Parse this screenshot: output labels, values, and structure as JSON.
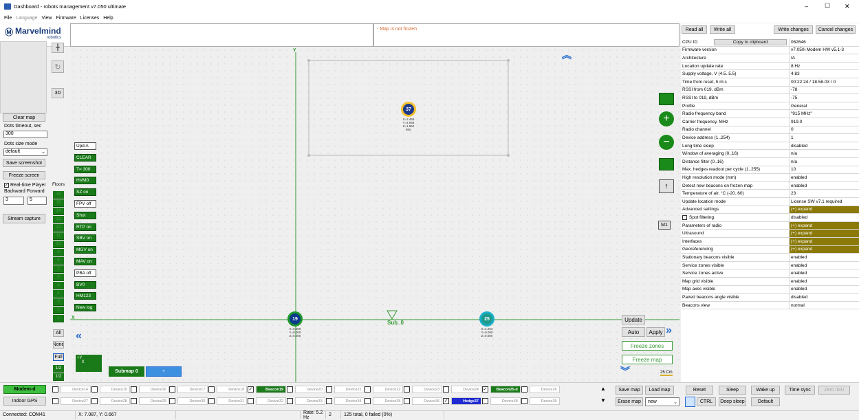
{
  "window": {
    "title": "Dashboard - robots management  v7.050  ultimate",
    "minimize": "–",
    "maximize": "☐",
    "close": "✕"
  },
  "menu": [
    "File",
    "Language",
    "View",
    "Firmware",
    "Licenses",
    "Help"
  ],
  "logo": {
    "name": "Marvelmind",
    "sub": "robotics"
  },
  "map_status": "- Map is not frozen",
  "left": {
    "clear_map": "Clear map",
    "dots_timeout_label": "Dots timeout, sec",
    "dots_timeout": "300",
    "dots_size_label": "Dots size mode",
    "dots_size": "default",
    "save_screenshot": "Save screenshot",
    "freeze_screen": "Freeze screen",
    "realtime_player": "Real-time Player",
    "backward": "Backward",
    "forward": "Forward",
    "backward_val": "3",
    "forward_val": "5",
    "stream_capture": "Stream capture",
    "view_3d": "3D"
  },
  "floors_label": "Floors",
  "floors": [
    "16",
    "15",
    "14",
    "13",
    "12",
    "11",
    "10",
    "9",
    "8",
    "7",
    "6",
    "5",
    "4",
    "3",
    "2",
    "1"
  ],
  "floor_buttons": {
    "all": "All",
    "none": "None",
    "full": "Full",
    "half1": "1/2",
    "half2": "1/2"
  },
  "map_buttons": [
    "Upd A",
    "CLEAR",
    "T= 300",
    "HVM0",
    "SZ on",
    "FPV off",
    "Shot",
    "RTP on",
    "SBV on",
    "MGV on",
    "MAV on",
    "PBA off",
    "BV0",
    "HM123",
    "New log"
  ],
  "map": {
    "x_axis": "X",
    "y_axis": "Y",
    "sub0": "Sub_0",
    "submap_label": "Submap 0",
    "submap_add": "+",
    "m1": "M1",
    "scale": "25 Cm"
  },
  "beacons": [
    {
      "id": "37",
      "coords": "X=2.469\nY=4.693\nZ=1.550\nIMU",
      "color": "#1e3a8a",
      "ring": "#f2c12e"
    },
    {
      "id": "19",
      "coords": "X=0.000\nY=0.000\nZ=0.000",
      "color": "#0b3a8c",
      "ring": "#1e9a2a"
    },
    {
      "id": "25",
      "coords": "X=4.203\nY=0.000\nZ=0.000",
      "color": "#1e9a8c",
      "ring": "#19b0c9"
    }
  ],
  "map_right_buttons": {
    "update": "Update",
    "auto": "Auto",
    "apply": "Apply",
    "freeze_zones": "Freeze zones",
    "freeze_map": "Freeze map"
  },
  "top_right_buttons": {
    "read_all": "Read all",
    "write_all": "Write all",
    "write_changes": "Write changes",
    "cancel_changes": "Cancel changes"
  },
  "props": [
    [
      "CPU ID",
      "062646"
    ],
    [
      "Firmware version",
      "v7.050i Modem HW v5.1-3"
    ],
    [
      "Architecture",
      "IA"
    ],
    [
      "Location update rate",
      "8 Hz"
    ],
    [
      "Supply voltage, V (4.5..5.5)",
      "4.83"
    ],
    [
      "Time from reset, h:m:s",
      "00:22:24 / 18.58.03 / 0"
    ],
    [
      "RSSI from 019, dBm",
      "-78"
    ],
    [
      "RSSI to 019, dBm",
      "-75"
    ],
    [
      "Profile",
      "General"
    ],
    [
      "Radio frequency band",
      "\"915 MHz\""
    ],
    [
      "Carrier frequency, MHz",
      "919.0"
    ],
    [
      "Radio channel",
      "0"
    ],
    [
      "Device address (1..254)",
      "1"
    ],
    [
      "Long time sleep",
      "disabled"
    ],
    [
      "Window of averaging (0..16)",
      "n/a"
    ],
    [
      "Distance filter (0..16)",
      "n/a"
    ],
    [
      "Max. hedges readout per cycle (1..255)",
      "10"
    ],
    [
      "High resolution mode (mm)",
      "enabled"
    ],
    [
      "Detect new beacons on frozen map",
      "enabled"
    ],
    [
      "Temperature of air, °C (-20..60)",
      "23"
    ],
    [
      "Update location mode",
      "License SW v7.1 required"
    ],
    [
      "Advanced settings",
      "(+) expand"
    ],
    [
      "Spot filtering",
      "disabled"
    ],
    [
      "Parameters of radio",
      "(+) expand"
    ],
    [
      "Ultrasound",
      "(+) expand"
    ],
    [
      "Interfaces",
      "(+) expand"
    ],
    [
      "Georeferencing",
      "(+) expand"
    ],
    [
      "Stationary beacons visible",
      "enabled"
    ],
    [
      "Service zones visible",
      "enabled"
    ],
    [
      "Service zones active",
      "enabled"
    ],
    [
      "Map grid visible",
      "enabled"
    ],
    [
      "Map axes visible",
      "enabled"
    ],
    [
      "Paired beacons angle visible",
      "disabled"
    ],
    [
      "Beacons view",
      "normal"
    ]
  ],
  "copy_clipboard": "Copy to clipboard",
  "bottom": {
    "modem": "Modem-d",
    "indoor_gps": "Indoor GPS",
    "save_map": "Save map",
    "load_map": "Load map",
    "erase_map": "Erase map",
    "map_select": "new",
    "reset": "Reset",
    "sleep": "Sleep",
    "wake_up": "Wake up",
    "time_sync": "Time sync",
    "zero_imu": "Zero IMU",
    "ctrl": "CTRL",
    "deep_sleep": "Deep sleep",
    "default": "Default"
  },
  "devices_row1": [
    "Device14",
    "Device15",
    "Device16",
    "Device17",
    "Device18",
    "Beacon19",
    "Device20",
    "Device21",
    "Device22",
    "Device23",
    "Device24",
    "Beacon25-d",
    "Device26"
  ],
  "devices_row2": [
    "Device27",
    "Device28",
    "Device29",
    "Device30",
    "Device31",
    "Device32",
    "Device33",
    "Device34",
    "Device35",
    "Device36",
    "Hedge37",
    "Device38",
    "Device39"
  ],
  "statusbar": {
    "connected": "Connected: COM41",
    "xy": "X: 7.087, Y: 0.667",
    "rate": "Rate: 5.2 Hz",
    "num": "2",
    "total": "125 total, 0 failed (0%)"
  }
}
